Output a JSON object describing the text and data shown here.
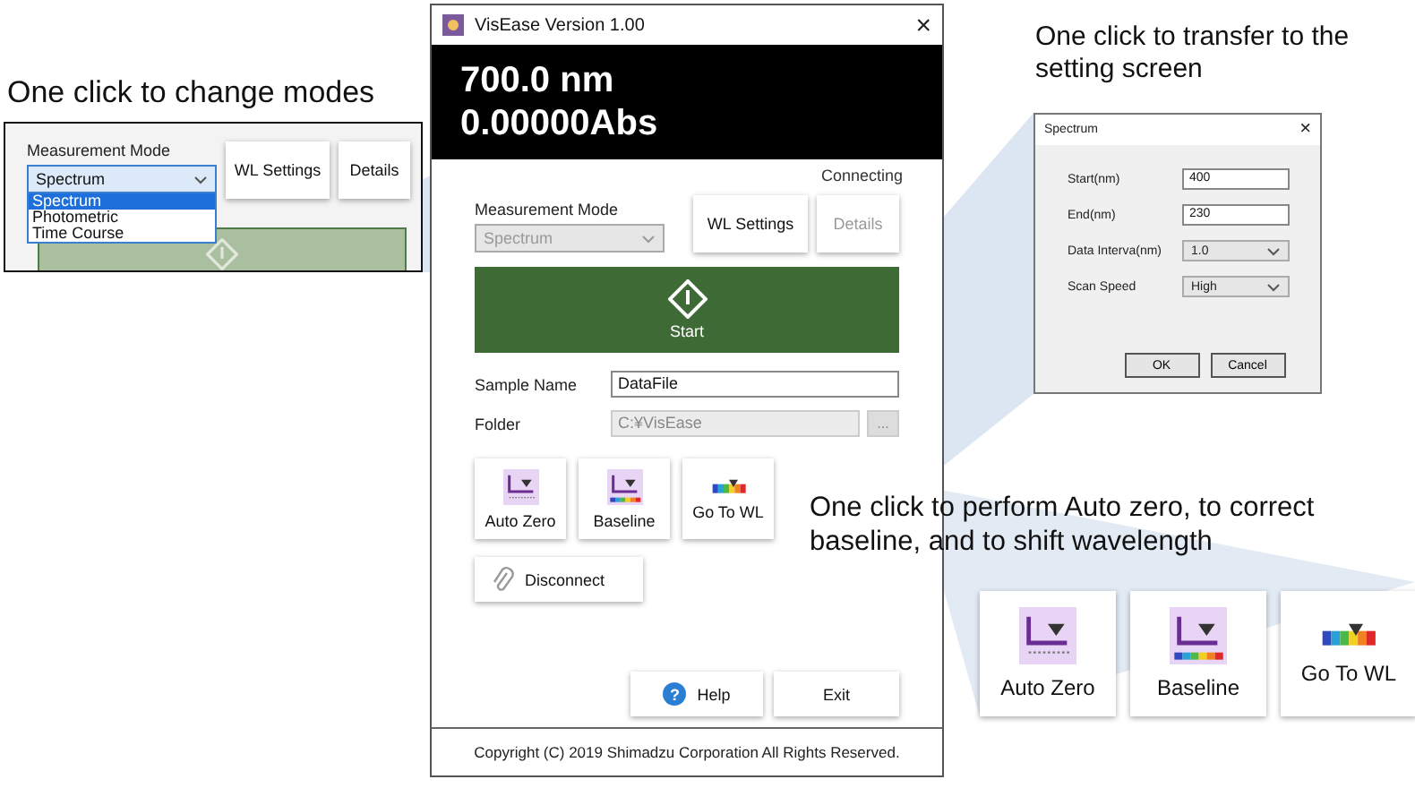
{
  "annotations": [
    {
      "text": "One click to change modes"
    },
    {
      "text": "One click to transfer to the setting screen"
    },
    {
      "text": "One click to perform Auto zero, to correct baseline, and to shift wavelength"
    }
  ],
  "mode_popup": {
    "label": "Measurement Mode",
    "value": "Spectrum",
    "expanded": true,
    "options": [
      {
        "label": "Spectrum",
        "selected": true
      },
      {
        "label": "Photometric",
        "selected": false
      },
      {
        "label": "Time Course",
        "selected": false
      }
    ],
    "buttons": [
      {
        "label": "WL Settings"
      },
      {
        "label": "Details"
      }
    ]
  },
  "window": {
    "title": "VisEase Version 1.00",
    "close": "×",
    "readout": {
      "wavelength": "700.0 nm",
      "absorbance": "0.00000Abs"
    },
    "status": "Connecting",
    "mode": {
      "label": "Measurement Mode",
      "value": "Spectrum",
      "disabled": true
    },
    "buttons": [
      {
        "label": "WL Settings",
        "disabled": false
      },
      {
        "label": "Details",
        "disabled": true
      }
    ],
    "start": {
      "label": "Start"
    },
    "fields": [
      {
        "label": "Sample Name",
        "value": "DataFile",
        "disabled": false
      },
      {
        "label": "Folder",
        "value": "C:¥VisEase",
        "disabled": true,
        "browse": "..."
      }
    ],
    "tools": [
      {
        "kind": "autozero",
        "label": "Auto Zero"
      },
      {
        "kind": "baseline",
        "label": "Baseline"
      },
      {
        "kind": "goto",
        "label": "Go To WL"
      }
    ],
    "disconnect": {
      "label": "Disconnect"
    },
    "footer_buttons": [
      {
        "kind": "help",
        "label": "Help",
        "glyph": "?"
      },
      {
        "kind": "plain",
        "label": "Exit"
      }
    ],
    "copyright": "Copyright (C) 2019 Shimadzu Corporation All Rights Reserved."
  },
  "dialog": {
    "title": "Spectrum",
    "close": "×",
    "rows": [
      {
        "kind": "input",
        "label": "Start(nm)",
        "value": "400"
      },
      {
        "kind": "input",
        "label": "End(nm)",
        "value": "230"
      },
      {
        "kind": "select",
        "label": "Data Interva(nm)",
        "value": "1.0"
      },
      {
        "kind": "select",
        "label": "Scan Speed",
        "value": "High"
      }
    ],
    "buttons": [
      {
        "label": "OK"
      },
      {
        "label": "Cancel"
      }
    ]
  },
  "zoomed_tools": [
    {
      "kind": "autozero",
      "label": "Auto Zero"
    },
    {
      "kind": "baseline",
      "label": "Baseline"
    },
    {
      "kind": "goto",
      "label": "Go To WL"
    }
  ]
}
